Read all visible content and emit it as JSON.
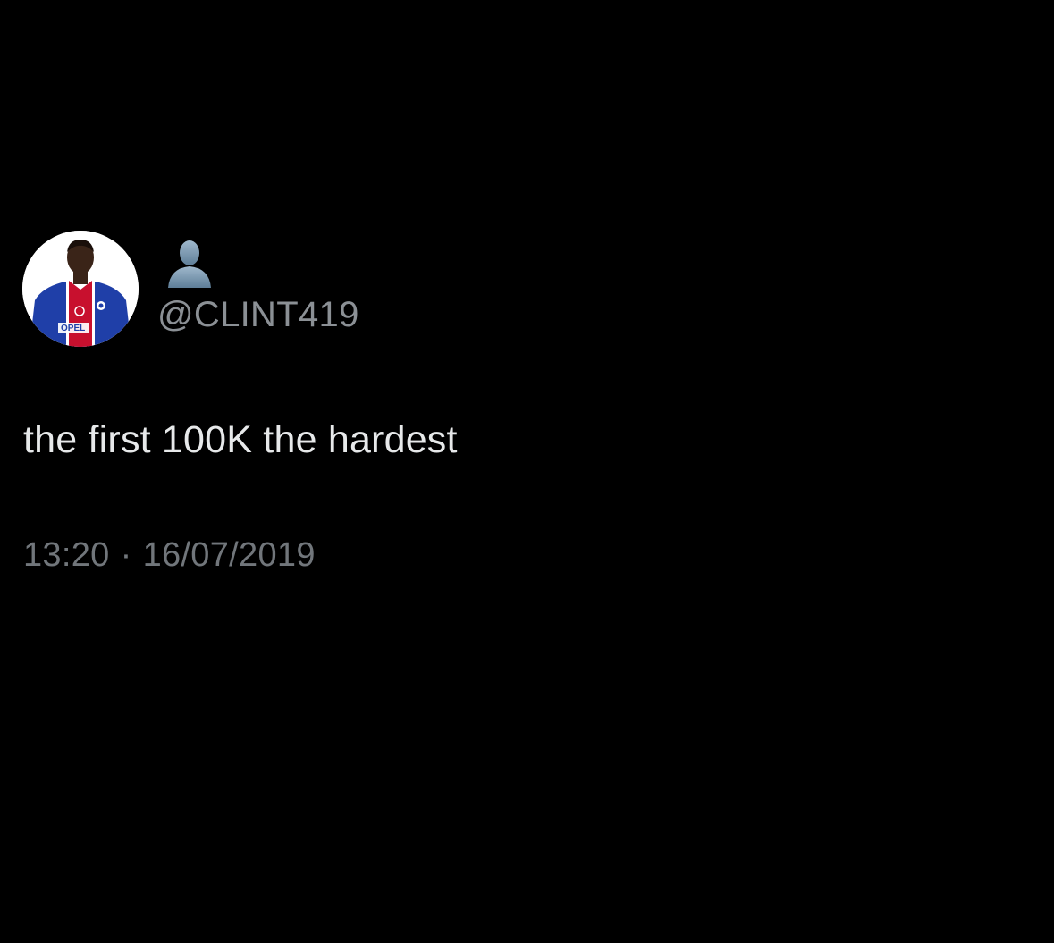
{
  "tweet": {
    "author": {
      "display_name_icon": "bust-in-silhouette-emoji",
      "handle": "@CLINT419",
      "avatar_jersey_text": "OPEL"
    },
    "text": "the first 100K the hardest",
    "time": "13:20",
    "separator": "·",
    "date": "16/07/2019"
  },
  "colors": {
    "background": "#000000",
    "primary_text": "#e7e9ea",
    "secondary_text": "#71767b",
    "jersey_blue": "#1f3fa8",
    "jersey_red": "#c8102e"
  }
}
